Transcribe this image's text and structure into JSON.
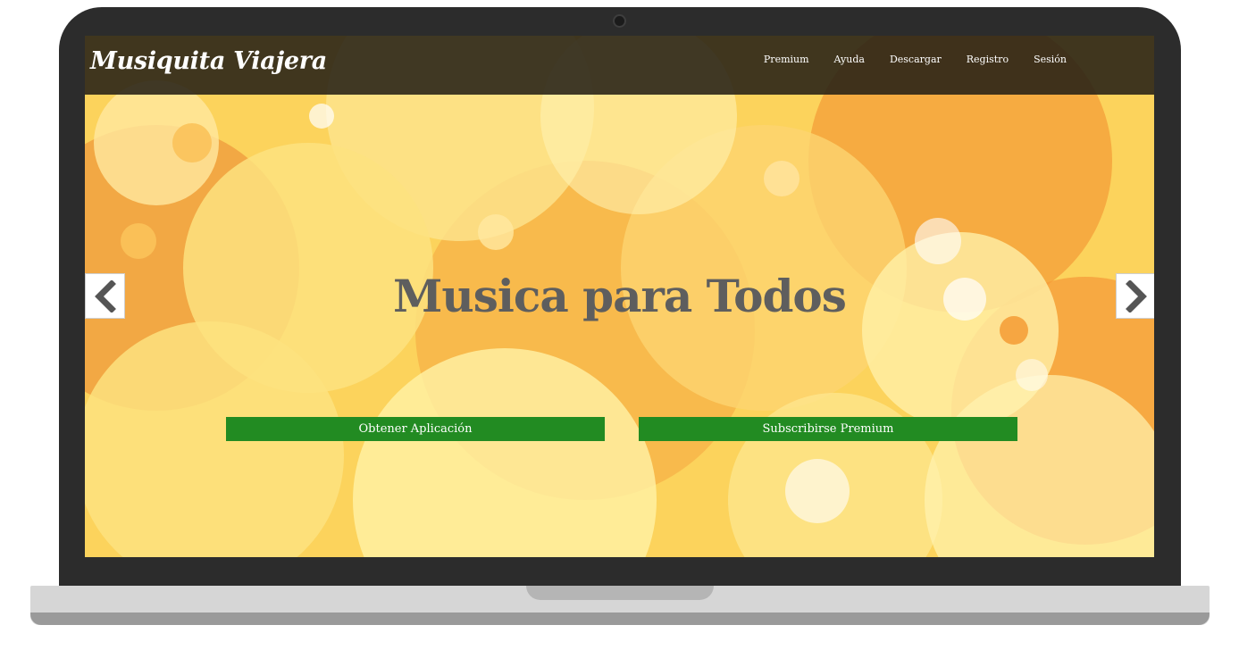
{
  "navbar": {
    "brand": "Musiquita Viajera",
    "links": [
      "Premium",
      "Ayuda",
      "Descargar",
      "Registro",
      "Sesión"
    ]
  },
  "hero": {
    "headline": "Musica para Todos",
    "primary_button": "Obtener Aplicación",
    "secondary_button": "Subscribirse Premium"
  },
  "carousel": {
    "prev_icon": "chevron-left-icon",
    "next_icon": "chevron-right-icon"
  },
  "colors": {
    "button_green": "#228b22",
    "navbar_bg": "#262016",
    "headline_gray": "#5e5e5e",
    "bokeh_yellow": "#fcd25a",
    "bokeh_orange": "#f29a3a"
  }
}
